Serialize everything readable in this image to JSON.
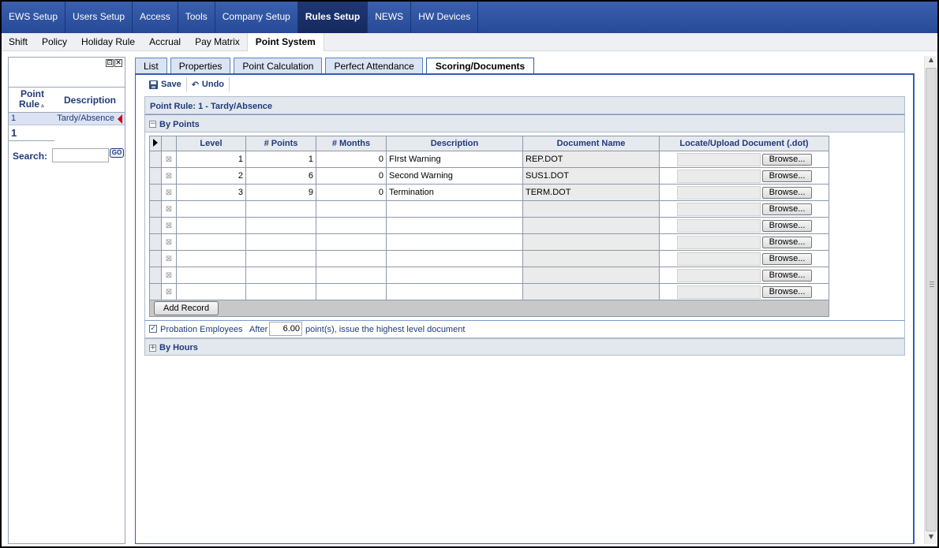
{
  "top_nav": [
    "EWS Setup",
    "Users Setup",
    "Access",
    "Tools",
    "Company Setup",
    "Rules Setup",
    "NEWS",
    "HW Devices"
  ],
  "top_nav_active": "Rules Setup",
  "sub_nav": [
    "Shift",
    "Policy",
    "Holiday Rule",
    "Accrual",
    "Pay Matrix",
    "Point System"
  ],
  "sub_nav_active": "Point System",
  "left_panel": {
    "col_point_rule": "Point Rule",
    "col_description": "Description",
    "rows": [
      {
        "rule": "1",
        "description": "Tardy/Absence"
      }
    ],
    "count": "1",
    "search_label": "Search:",
    "search_value": "",
    "go_label": "GO"
  },
  "tabs": [
    "List",
    "Properties",
    "Point Calculation",
    "Perfect Attendance",
    "Scoring/Documents"
  ],
  "active_tab": "Scoring/Documents",
  "toolbar": {
    "save": "Save",
    "undo": "Undo"
  },
  "point_rule_header": "Point Rule: 1 - Tardy/Absence",
  "by_points": {
    "title": "By Points",
    "columns": [
      "Level",
      "# Points",
      "# Months",
      "Description",
      "Document Name",
      "Locate/Upload Document (.dot)"
    ],
    "rows": [
      {
        "level": "1",
        "points": "1",
        "months": "0",
        "description": "FIrst Warning",
        "document": "REP.DOT"
      },
      {
        "level": "2",
        "points": "6",
        "months": "0",
        "description": "Second Warning",
        "document": "SUS1.DOT"
      },
      {
        "level": "3",
        "points": "9",
        "months": "0",
        "description": "Termination",
        "document": "TERM.DOT"
      },
      {
        "level": "",
        "points": "",
        "months": "",
        "description": "",
        "document": ""
      },
      {
        "level": "",
        "points": "",
        "months": "",
        "description": "",
        "document": ""
      },
      {
        "level": "",
        "points": "",
        "months": "",
        "description": "",
        "document": ""
      },
      {
        "level": "",
        "points": "",
        "months": "",
        "description": "",
        "document": ""
      },
      {
        "level": "",
        "points": "",
        "months": "",
        "description": "",
        "document": ""
      },
      {
        "level": "",
        "points": "",
        "months": "",
        "description": "",
        "document": ""
      }
    ],
    "browse_label": "Browse...",
    "add_record": "Add Record"
  },
  "probation": {
    "checked": true,
    "label": "Probation Employees",
    "after": "After",
    "value": "6.00",
    "suffix": "point(s), issue the highest level document"
  },
  "by_hours": {
    "title": "By Hours"
  },
  "colors": {
    "nav": "#264a96",
    "accent": "#2f5fb0",
    "text_link": "#1f3b7a",
    "marker": "#d40000"
  }
}
